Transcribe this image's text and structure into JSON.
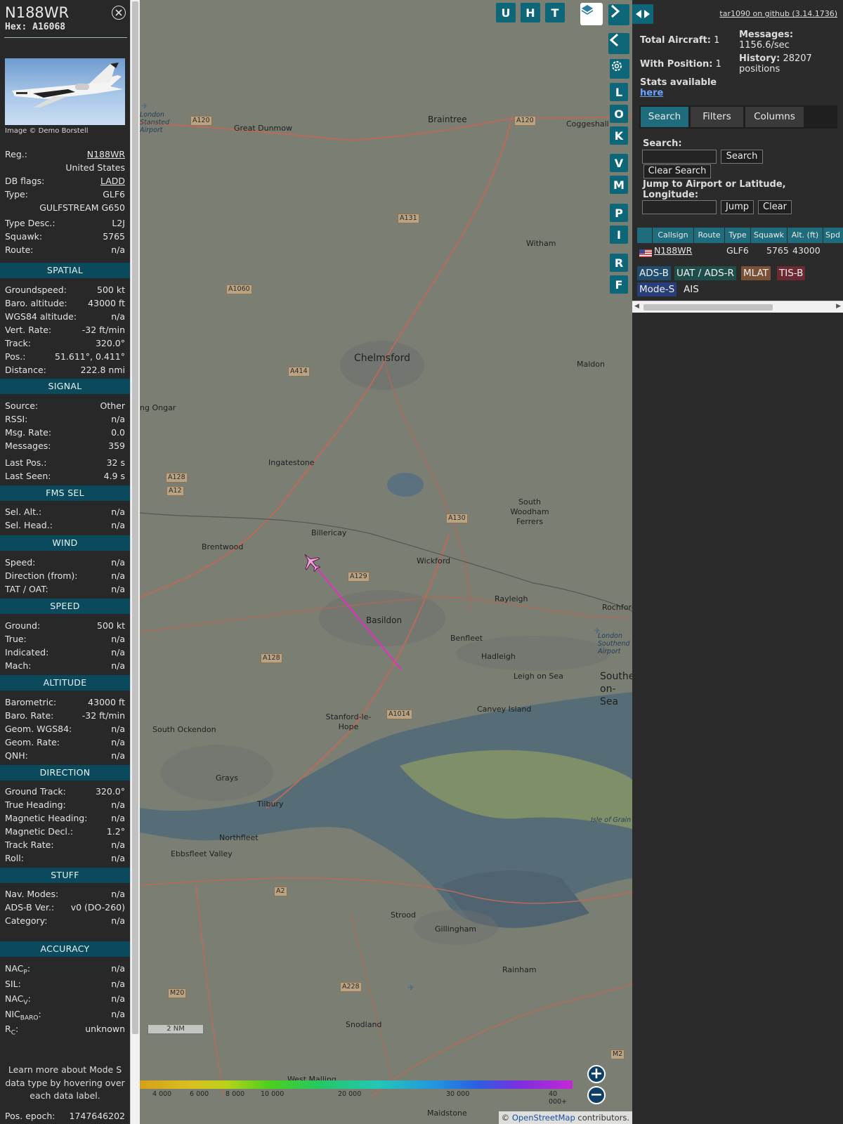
{
  "info": {
    "callsign": "N188WR",
    "hex_label": "Hex:",
    "hex": "A16068",
    "photo_caption": "Image © Demo Borstell",
    "reg_label": "Reg.:",
    "reg": "N188WR",
    "country": "United States",
    "dbflags_label": "DB flags:",
    "dbflags": "LADD",
    "type_label": "Type:",
    "type": "GLF6",
    "type_full": "GULFSTREAM G650",
    "typedesc_label": "Type Desc.:",
    "typedesc": "L2J",
    "squawk_label": "Squawk:",
    "squawk": "5765",
    "route_label": "Route:",
    "route": "n/a",
    "sections": {
      "spatial": "SPATIAL",
      "signal": "SIGNAL",
      "fms": "FMS SEL",
      "wind": "WIND",
      "speed": "SPEED",
      "altitude": "ALTITUDE",
      "direction": "DIRECTION",
      "stuff": "STUFF",
      "accuracy": "ACCURACY"
    },
    "spatial": [
      {
        "k": "Groundspeed:",
        "v": "500 kt"
      },
      {
        "k": "Baro. altitude:",
        "v": "43000 ft"
      },
      {
        "k": "WGS84 altitude:",
        "v": "n/a"
      },
      {
        "k": "Vert. Rate:",
        "v": "-32 ft/min"
      },
      {
        "k": "Track:",
        "v": "320.0°"
      },
      {
        "k": "Pos.:",
        "v": "51.611°, 0.411°"
      },
      {
        "k": "Distance:",
        "v": "222.8 nmi"
      }
    ],
    "signal": [
      {
        "k": "Source:",
        "v": "Other"
      },
      {
        "k": "RSSI:",
        "v": "n/a"
      },
      {
        "k": "Msg. Rate:",
        "v": "0.0"
      },
      {
        "k": "Messages:",
        "v": "359"
      },
      {
        "k": "Last Pos.:",
        "v": "32 s"
      },
      {
        "k": "Last Seen:",
        "v": "4.9 s"
      }
    ],
    "fms": [
      {
        "k": "Sel. Alt.:",
        "v": "n/a"
      },
      {
        "k": "Sel. Head.:",
        "v": "n/a"
      }
    ],
    "wind": [
      {
        "k": "Speed:",
        "v": "n/a"
      },
      {
        "k": "Direction (from):",
        "v": "n/a"
      },
      {
        "k": "TAT / OAT:",
        "v": "n/a"
      }
    ],
    "speed": [
      {
        "k": "Ground:",
        "v": "500 kt"
      },
      {
        "k": "True:",
        "v": "n/a"
      },
      {
        "k": "Indicated:",
        "v": "n/a"
      },
      {
        "k": "Mach:",
        "v": "n/a"
      }
    ],
    "altitude": [
      {
        "k": "Barometric:",
        "v": "43000 ft"
      },
      {
        "k": "Baro. Rate:",
        "v": "-32 ft/min"
      },
      {
        "k": "Geom. WGS84:",
        "v": "n/a"
      },
      {
        "k": "Geom. Rate:",
        "v": "n/a"
      },
      {
        "k": "QNH:",
        "v": "n/a"
      }
    ],
    "direction": [
      {
        "k": "Ground Track:",
        "v": "320.0°"
      },
      {
        "k": "True Heading:",
        "v": "n/a"
      },
      {
        "k": "Magnetic Heading:",
        "v": "n/a"
      },
      {
        "k": "Magnetic Decl.:",
        "v": "1.2°"
      },
      {
        "k": "Track Rate:",
        "v": "n/a"
      },
      {
        "k": "Roll:",
        "v": "n/a"
      }
    ],
    "stuff": [
      {
        "k": "Nav. Modes:",
        "v": "n/a"
      },
      {
        "k": "ADS-B Ver.:",
        "v": "v0 (DO-260)"
      },
      {
        "k": "Category:",
        "v": "n/a"
      }
    ],
    "accuracy": [
      {
        "k": "NAC",
        "sub": "P",
        "v": "n/a"
      },
      {
        "k": "SIL:",
        "sub": "",
        "v": "n/a"
      },
      {
        "k": "NAC",
        "sub": "V",
        "v": "n/a"
      },
      {
        "k": "NIC",
        "sub": "BARO",
        "v": "n/a"
      },
      {
        "k": "R",
        "sub": "C",
        "v": "unknown"
      }
    ],
    "help_text": "Learn more about Mode S data type by hovering over each data label.",
    "pos_epoch_label": "Pos. epoch:",
    "pos_epoch": "1747646202"
  },
  "map": {
    "buttons": [
      "U",
      "H",
      "T"
    ],
    "side_buttons": [
      "L",
      "O",
      "K",
      "V",
      "M",
      "P",
      "I",
      "R",
      "F"
    ],
    "places": [
      {
        "t": "Braintree",
        "c": "mid"
      },
      {
        "t": "Great Dunmow",
        "c": ""
      },
      {
        "t": "Coggeshall",
        "c": ""
      },
      {
        "t": "Witham",
        "c": ""
      },
      {
        "t": "Chelmsford",
        "c": "big"
      },
      {
        "t": "Maldon",
        "c": ""
      },
      {
        "t": "Ingatestone",
        "c": ""
      },
      {
        "t": "ng Ongar",
        "c": ""
      },
      {
        "t": "South Woodham Ferrers",
        "c": ""
      },
      {
        "t": "Billericay",
        "c": ""
      },
      {
        "t": "Brentwood",
        "c": ""
      },
      {
        "t": "Wickford",
        "c": ""
      },
      {
        "t": "Rayleigh",
        "c": ""
      },
      {
        "t": "Rochford",
        "c": ""
      },
      {
        "t": "Basildon",
        "c": "mid"
      },
      {
        "t": "Benfleet",
        "c": ""
      },
      {
        "t": "Hadleigh",
        "c": ""
      },
      {
        "t": "Leigh on Sea",
        "c": ""
      },
      {
        "t": "Southend-on-Sea",
        "c": "big"
      },
      {
        "t": "Canvey Island",
        "c": ""
      },
      {
        "t": "Stanford-le-Hope",
        "c": ""
      },
      {
        "t": "South Ockendon",
        "c": ""
      },
      {
        "t": "Grays",
        "c": ""
      },
      {
        "t": "Tilbury",
        "c": ""
      },
      {
        "t": "Northfleet",
        "c": ""
      },
      {
        "t": "Ebbsfleet Valley",
        "c": ""
      },
      {
        "t": "Isle of Grain",
        "c": ""
      },
      {
        "t": "Strood",
        "c": ""
      },
      {
        "t": "Gillingham",
        "c": ""
      },
      {
        "t": "Rainham",
        "c": ""
      },
      {
        "t": "Snodland",
        "c": ""
      },
      {
        "t": "West Malling",
        "c": ""
      },
      {
        "t": "Maidstone",
        "c": ""
      },
      {
        "t": "London Stansted Airport",
        "c": ""
      },
      {
        "t": "London Southend Airport",
        "c": ""
      }
    ],
    "roads": [
      "A120",
      "A120",
      "A131",
      "A1060",
      "A414",
      "A12",
      "A128",
      "A130",
      "A129",
      "A128",
      "A1014",
      "A2",
      "A228",
      "M20",
      "M2"
    ],
    "legend": [
      "4 000",
      "6 000",
      "8 000",
      "10 000",
      "20 000",
      "30 000",
      "40 000+"
    ],
    "scale": "2 NM",
    "attribution_prefix": "©",
    "attribution_link": "OpenStreetMap",
    "attribution_suffix": "contributors."
  },
  "right": {
    "github": "tar1090 on github (3.14.1736)",
    "total_label": "Total Aircraft:",
    "total": "1",
    "withpos_label": "With Position:",
    "withpos": "1",
    "stats_text": "Stats available",
    "stats_link": "here",
    "messages_label": "Messages:",
    "messages": "1156.6/sec",
    "history_label": "History:",
    "history": "28207",
    "history_unit": "positions",
    "tabs": [
      "Search",
      "Filters",
      "Columns"
    ],
    "search_label": "Search:",
    "search_button": "Search",
    "clear_search_button": "Clear Search",
    "jump_label": "Jump to Airport or Latitude, Longitude:",
    "jump_button": "Jump",
    "clear_button": "Clear",
    "columns": [
      "",
      "Callsign",
      "Route",
      "Type",
      "Squawk",
      "Alt. (ft)",
      "Spd"
    ],
    "row": {
      "callsign": "N188WR",
      "type": "GLF6",
      "squawk": "5765",
      "alt": "43000"
    },
    "badges": [
      {
        "t": "ADS-B",
        "color": "#1e4b6e"
      },
      {
        "t": "UAT / ADS-R",
        "color": "#1f4e4a"
      },
      {
        "t": "MLAT",
        "color": "#7b5136"
      },
      {
        "t": "TIS-B",
        "color": "#6e2a32"
      },
      {
        "t": "Mode-S",
        "color": "#283e7a"
      },
      {
        "t": "AIS",
        "color": "#2b2b2b"
      }
    ]
  }
}
